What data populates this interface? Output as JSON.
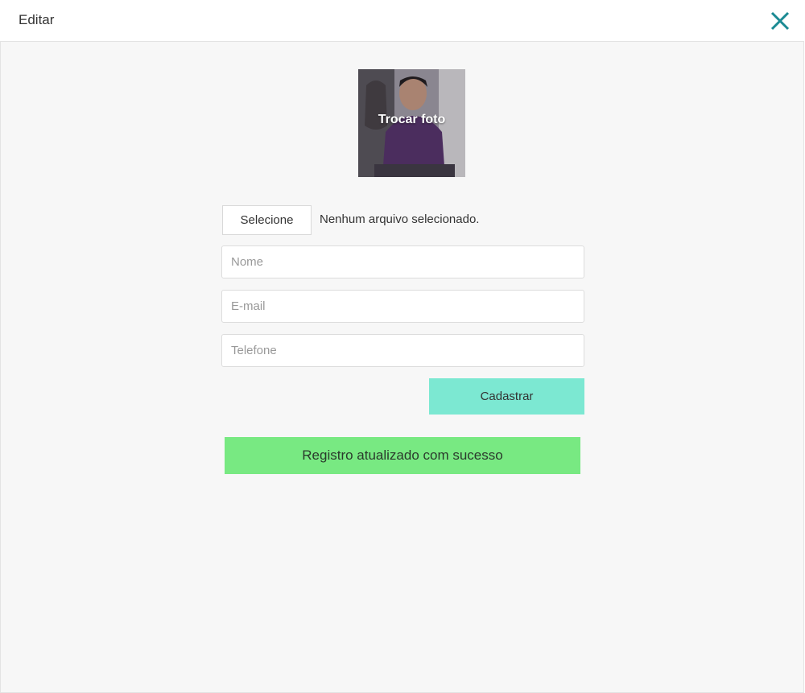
{
  "header": {
    "title": "Editar",
    "close_icon": "close-icon",
    "close_color": "#1a8a93"
  },
  "photo": {
    "overlay_label": "Trocar foto"
  },
  "file_input": {
    "button_label": "Selecione",
    "status_text": "Nenhum arquivo selecionado."
  },
  "form": {
    "name_placeholder": "Nome",
    "name_value": "",
    "email_placeholder": "E-mail",
    "email_value": "",
    "phone_placeholder": "Telefone",
    "phone_value": "",
    "submit_label": "Cadastrar",
    "submit_color": "#7ce8d2"
  },
  "alert": {
    "message": "Registro atualizado com sucesso",
    "color": "#78e982"
  }
}
